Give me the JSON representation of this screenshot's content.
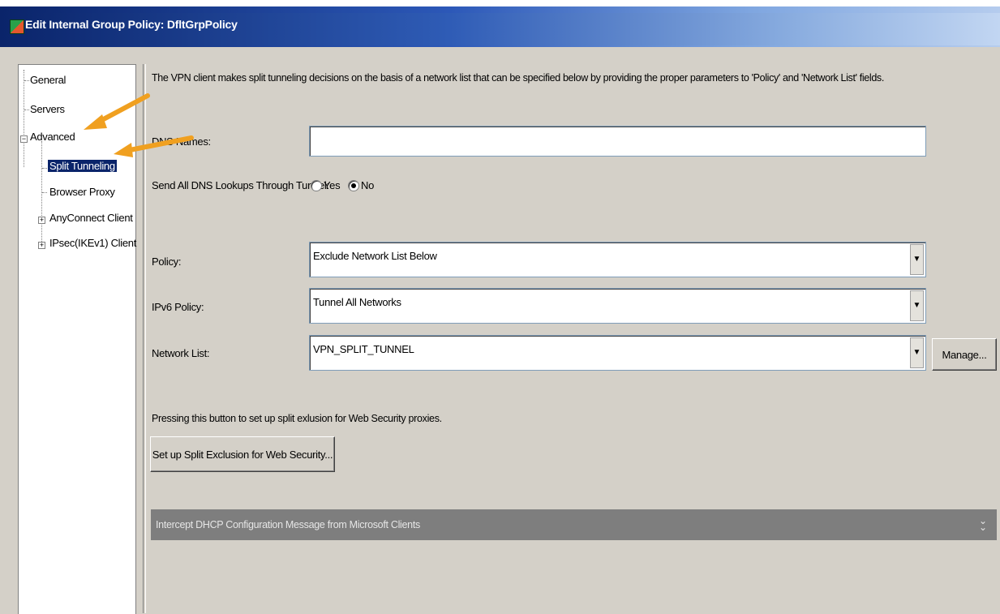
{
  "window": {
    "title": "Edit Internal Group Policy: DfltGrpPolicy"
  },
  "tree": {
    "items": [
      {
        "label": "General"
      },
      {
        "label": "Servers"
      },
      {
        "label": "Advanced"
      },
      {
        "label": "Split Tunneling"
      },
      {
        "label": "Browser Proxy"
      },
      {
        "label": "AnyConnect Client"
      },
      {
        "label": "IPsec(IKEv1) Client"
      }
    ],
    "selected": "Split Tunneling"
  },
  "main": {
    "description": "The VPN client makes split tunneling decisions on the basis of a network list that can be specified below by providing the proper parameters to 'Policy' and 'Network List' fields.",
    "dns_names": {
      "label": "DNS Names:",
      "value": ""
    },
    "dns_lookups": {
      "label": "Send All DNS Lookups Through Tunnel:",
      "yes_label": "Yes",
      "no_label": "No",
      "selected": "No"
    },
    "policy": {
      "label": "Policy:",
      "value": "Exclude Network List Below"
    },
    "ipv6_policy": {
      "label": "IPv6 Policy:",
      "value": "Tunnel All Networks"
    },
    "network_list": {
      "label": "Network List:",
      "value": "VPN_SPLIT_TUNNEL",
      "manage_label": "Manage..."
    },
    "web_security_note": "Pressing this button to set up split exlusion for Web Security proxies.",
    "web_security_button": "Set up Split Exclusion for Web Security...",
    "intercept_dhcp": "Intercept DHCP Configuration Message from Microsoft Clients"
  },
  "colors": {
    "titlebar_start": "#0a246a",
    "titlebar_end": "#c2d6f2",
    "selection": "#0a246a",
    "annotation_arrow": "#f0a020",
    "section_bar": "#7e7e7e"
  },
  "icons": {
    "app_icon": "asdm-icon",
    "dropdown": "chevron-down-icon",
    "expand_section": "double-chevron-down-icon",
    "tree_expand": "plus-box-icon",
    "tree_collapse": "minus-box-icon",
    "annotation": "pointer-arrow-icon"
  }
}
